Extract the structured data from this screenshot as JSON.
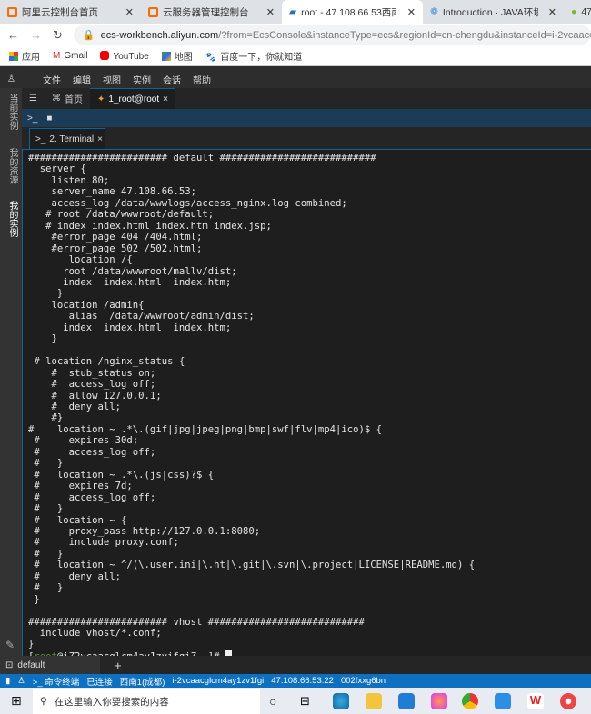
{
  "browser": {
    "tabs": [
      {
        "label": "阿里云控制台首页",
        "active": false
      },
      {
        "label": "云服务器管理控制台",
        "active": false
      },
      {
        "label": "root - 47.108.66.53西南1(",
        "active": true
      },
      {
        "label": "Introduction · JAVA环境",
        "active": false
      },
      {
        "label": "47.",
        "active": false
      }
    ],
    "url_host": "ecs-workbench.aliyun.com",
    "url_rest": "/?from=EcsConsole&instanceType=ecs&regionId=cn-chengdu&instanceId=i-2vcaacg",
    "bookmarks": [
      "应用",
      "Gmail",
      "YouTube",
      "地图",
      "百度一下，你就知道"
    ]
  },
  "app": {
    "menu": [
      "文件",
      "编辑",
      "视图",
      "实例",
      "会话",
      "帮助"
    ],
    "sidebar": [
      "当前实例",
      "我的资源",
      "我的实例"
    ],
    "tabs": [
      {
        "label": "首页"
      },
      {
        "label": "1_root@root"
      }
    ],
    "terminal_tab": "2. Terminal",
    "terminal_lines": [
      "######################## default ###########################",
      "  server {",
      "    listen 80;",
      "    server_name 47.108.66.53;",
      "    access_log /data/wwwlogs/access_nginx.log combined;",
      "   # root /data/wwwroot/default;",
      "   # index index.html index.htm index.jsp;",
      "    #error_page 404 /404.html;",
      "    #error_page 502 /502.html;",
      "       location /{",
      "      root /data/wwwroot/mallv/dist;",
      "      index  index.html  index.htm;",
      "     }",
      "    location /admin{",
      "       alias  /data/wwwroot/admin/dist;",
      "      index  index.html  index.htm;",
      "    }",
      "",
      " # location /nginx_status {",
      "    #  stub_status on;",
      "    #  access_log off;",
      "    #  allow 127.0.0.1;",
      "    #  deny all;",
      "    #}",
      "#    location ~ .*\\.(gif|jpg|jpeg|png|bmp|swf|flv|mp4|ico)$ {",
      " #     expires 30d;",
      " #     access_log off;",
      " #   }",
      " #   location ~ .*\\.(js|css)?$ {",
      " #     expires 7d;",
      " #     access_log off;",
      " #   }",
      " #   location ~ {",
      " #     proxy_pass http://127.0.0.1:8080;",
      " #     include proxy.conf;",
      " #   }",
      " #   location ~ ^/(\\.user.ini|\\.ht|\\.git|\\.svn|\\.project|LICENSE|README.md) {",
      " #     deny all;",
      " #   }",
      " }",
      "",
      "######################## vhost ###########################",
      "  include vhost/*.conf;",
      "}"
    ],
    "prompt": {
      "open": "[",
      "user": "root",
      "host": "@iZ2vcaacglcm4ay1zvifgiZ ~]# "
    },
    "bottom_tab": "default",
    "add_label": "+",
    "status": [
      "命令终端",
      "已连接",
      "西南1(成都)",
      "i-2vcaacglcm4ay1zv1fgi",
      "47.108.66.53:22",
      "002fxxg6bn"
    ]
  },
  "taskbar": {
    "search_placeholder": "在这里输入你要搜索的内容"
  },
  "colors": {
    "accent": "#0e70c0",
    "terminal_bg": "#1e1e1e",
    "prompt_user": "#5a8a3a"
  }
}
